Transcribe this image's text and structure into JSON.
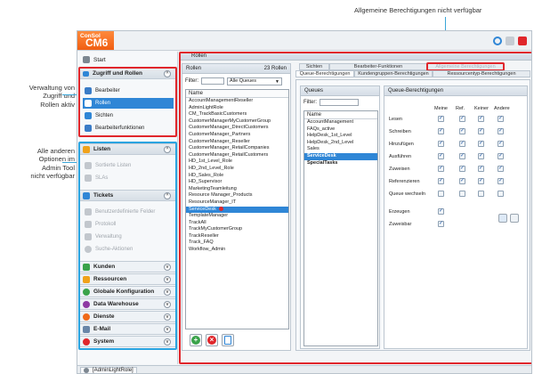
{
  "annotations": {
    "top": "Allgemeine Berechtigungen nicht verfügbar",
    "left1": [
      "Verwaltung von",
      "Zugriff und",
      "Rollen aktiv"
    ],
    "left2": [
      "Alle anderen",
      "Optionen im",
      "Admin Tool",
      "nicht verfügbar"
    ]
  },
  "app": {
    "logo_small": "ConSol",
    "logo_big": "CM6"
  },
  "nav": {
    "start": "Start",
    "access_group": "Zugriff und Rollen",
    "access_items": [
      "Bearbeiter",
      "Rollen",
      "Sichten",
      "Bearbeiterfunktionen"
    ],
    "lists_group": "Listen",
    "lists_items": [
      "Sortierte Listen",
      "SLAs"
    ],
    "tickets_group": "Tickets",
    "tickets_items": [
      "Benutzerdefinierte Felder",
      "Protokoll",
      "Verwaltung",
      "Suche-Aktionen"
    ],
    "other_groups": [
      "Kunden",
      "Ressourcen",
      "Globale Konfiguration",
      "Data Warehouse",
      "Dienste",
      "E-Mail",
      "System"
    ]
  },
  "main": {
    "title": "Rollen",
    "roles": {
      "header": "Rollen",
      "count": "23 Rollen",
      "filter_label": "Filter:",
      "queue_select": "Alle Queues",
      "column": "Name",
      "items": [
        "AccountManagementReseller",
        "AdminLightRole",
        "CM_TrackBasicCustomers",
        "CustomerManagerMyCustomerGroup",
        "CustomerManager_DirectCustomers",
        "CustomerManager_Partners",
        "CustomerManager_Reseller",
        "CustomerManager_RetailCompanies",
        "CustomerManager_RetailCustomers",
        "HD_1st_Level_Role",
        "HD_2nd_Level_Role",
        "HD_Sales_Role",
        "HD_Supervisor",
        "MarketingTeamleitung",
        "Resource Manager_Products",
        "ResourceManager_IT",
        "ServiceDesk",
        "TemplateManager",
        "TrackAll",
        "TrackMyCustomerGroup",
        "TrackReseller",
        "Track_FAQ",
        "Workflow_Admin"
      ],
      "selected_index": 16
    },
    "tabs_top": [
      "Sichten",
      "Bearbeiter-Funktionen",
      "Allgemeine Berechtigungen"
    ],
    "tabs_bottom": [
      "Queue-Berechtigungen",
      "Kundengruppen-Berechtigungen",
      "Ressourcentyp-Berechtigungen"
    ],
    "queues": {
      "header": "Queues",
      "filter_label": "Filter:",
      "column": "Name",
      "items": [
        "AccountManagement",
        "FAQs_active",
        "HelpDesk_1st_Level",
        "HelpDesk_2nd_Level",
        "Sales",
        "ServiceDesk",
        "SpecialTasks"
      ],
      "selected_index": 5,
      "bold_index": 6
    },
    "perms": {
      "header": "Queue-Berechtigungen",
      "columns": [
        "Meine",
        "Ref.",
        "Keiner",
        "Andere"
      ],
      "rows": [
        {
          "label": "Lesen",
          "checks": [
            true,
            true,
            true,
            true
          ]
        },
        {
          "label": "Schreiben",
          "checks": [
            true,
            true,
            true,
            true
          ]
        },
        {
          "label": "Hinzufügen",
          "checks": [
            true,
            true,
            true,
            true
          ]
        },
        {
          "label": "Ausführen",
          "checks": [
            true,
            true,
            true,
            true
          ]
        },
        {
          "label": "Zuweisen",
          "checks": [
            true,
            true,
            true,
            true
          ]
        },
        {
          "label": "Referenzieren",
          "checks": [
            true,
            true,
            true,
            true
          ]
        },
        {
          "label": "Queue wechseln",
          "checks": [
            false,
            false,
            false,
            false
          ]
        }
      ],
      "extra": [
        {
          "label": "Erzeugen",
          "checked": true
        },
        {
          "label": "Zuweisbar",
          "checked": true
        }
      ]
    }
  },
  "status": {
    "user": "[AdminLightRole]"
  }
}
